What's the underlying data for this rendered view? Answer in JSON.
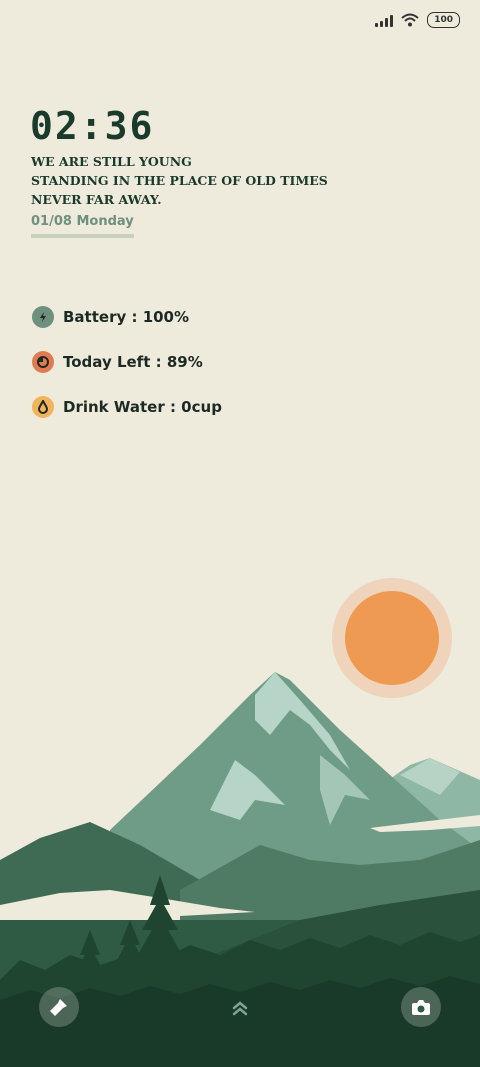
{
  "status_bar": {
    "battery_level": "100",
    "signal_icon": "signal-icon",
    "wifi_icon": "wifi-icon"
  },
  "lockscreen": {
    "time": "02:36",
    "quote_lines": [
      "WE ARE STILL YOUNG",
      "STANDING IN THE PLACE OF OLD TIMES",
      "NEVER FAR AWAY."
    ],
    "date": "01/08 Monday"
  },
  "widgets": [
    {
      "label": "Battery : 100%",
      "icon": "battery-leaf-icon",
      "color": "#6f8f7f"
    },
    {
      "label": "Today Left : 89%",
      "icon": "day-progress-icon",
      "color": "#e07b4f"
    },
    {
      "label": "Drink Water : 0cup",
      "icon": "water-drop-icon",
      "color": "#f2b45a"
    }
  ],
  "bottom_bar": {
    "left_icon": "flashlight-icon",
    "center_icon": "swipe-up-icon",
    "right_icon": "camera-icon"
  },
  "colors": {
    "background": "#eeeadc",
    "text_dark": "#1a3a2c",
    "sun": "#ee9a52",
    "sun_halo": "#efd3ba",
    "mountain_light": "#8fb7a5",
    "forest_dark": "#1f4530"
  }
}
